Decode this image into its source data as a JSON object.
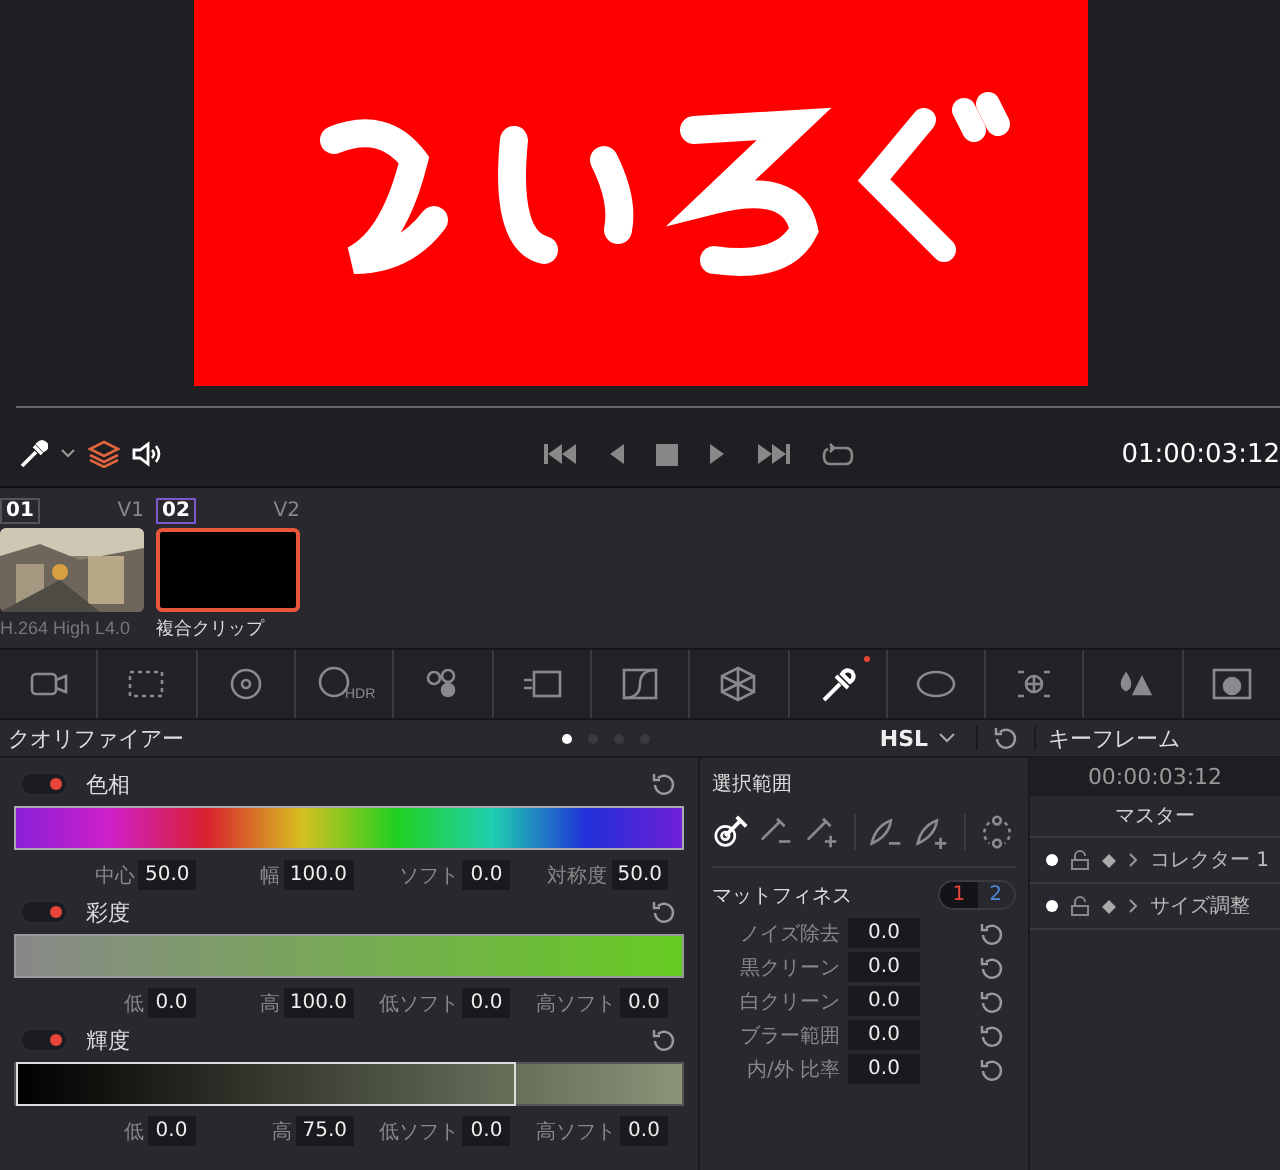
{
  "transport": {
    "timecode": "01:00:03:12"
  },
  "clips": [
    {
      "number": "01",
      "track": "V1",
      "label": "H.264 High L4.0",
      "selected": false,
      "kind": "picture"
    },
    {
      "number": "02",
      "track": "V2",
      "label": "複合クリップ",
      "selected": true,
      "kind": "black"
    }
  ],
  "tools": [
    {
      "kind": "raw",
      "selected": false
    },
    {
      "kind": "match",
      "selected": false
    },
    {
      "kind": "wheels",
      "selected": false
    },
    {
      "kind": "hdr",
      "label": "HDR",
      "selected": false
    },
    {
      "kind": "rgbmix",
      "selected": false
    },
    {
      "kind": "motion",
      "selected": false
    },
    {
      "kind": "curves",
      "selected": false
    },
    {
      "kind": "warper",
      "selected": false
    },
    {
      "kind": "qualifier",
      "selected": true
    },
    {
      "kind": "window",
      "selected": false
    },
    {
      "kind": "tracker",
      "selected": false
    },
    {
      "kind": "blur",
      "selected": false
    },
    {
      "kind": "key",
      "selected": false
    }
  ],
  "qualifier": {
    "title": "クオリファイアー",
    "pages": [
      {
        "selected": true
      },
      {
        "selected": false
      },
      {
        "selected": false
      },
      {
        "selected": false
      }
    ],
    "mode": "HSL",
    "sections": [
      {
        "title": "色相",
        "on": true,
        "kind": "hue",
        "fields": [
          {
            "label": "中心",
            "value": "50.0"
          },
          {
            "label": "幅",
            "value": "100.0"
          },
          {
            "label": "ソフト",
            "value": "0.0"
          },
          {
            "label": "対称度",
            "value": "50.0"
          }
        ]
      },
      {
        "title": "彩度",
        "on": true,
        "kind": "sat",
        "fields": [
          {
            "label": "低",
            "value": "0.0"
          },
          {
            "label": "高",
            "value": "100.0"
          },
          {
            "label": "低ソフト",
            "value": "0.0"
          },
          {
            "label": "高ソフト",
            "value": "0.0"
          }
        ]
      },
      {
        "title": "輝度",
        "on": true,
        "kind": "lum",
        "level": 0.75,
        "fields": [
          {
            "label": "低",
            "value": "0.0"
          },
          {
            "label": "高",
            "value": "75.0"
          },
          {
            "label": "低ソフト",
            "value": "0.0"
          },
          {
            "label": "高ソフト",
            "value": "0.0"
          }
        ]
      }
    ]
  },
  "selection": {
    "title": "選択範囲",
    "tools": [
      {
        "kind": "picker",
        "selected": true
      },
      {
        "kind": "picker-minus",
        "selected": false
      },
      {
        "kind": "picker-plus",
        "selected": false
      },
      {
        "kind": "feather-minus",
        "selected": false
      },
      {
        "kind": "feather-plus",
        "selected": false
      },
      {
        "kind": "invert",
        "selected": false
      }
    ]
  },
  "matte": {
    "title": "マットフィネス",
    "tabs": [
      {
        "label": "1",
        "selected": true
      },
      {
        "label": "2",
        "selected": false
      }
    ],
    "fields": [
      {
        "label": "ノイズ除去",
        "value": "0.0"
      },
      {
        "label": "黒クリーン",
        "value": "0.0"
      },
      {
        "label": "白クリーン",
        "value": "0.0"
      },
      {
        "label": "ブラー範囲",
        "value": "0.0"
      },
      {
        "label": "内/外 比率",
        "value": "0.0"
      }
    ]
  },
  "keyframes": {
    "title": "キーフレーム",
    "timecode": "00:00:03:12",
    "master": "マスター",
    "rows": [
      {
        "label": "コレクター 1"
      },
      {
        "label": "サイズ調整"
      }
    ]
  }
}
